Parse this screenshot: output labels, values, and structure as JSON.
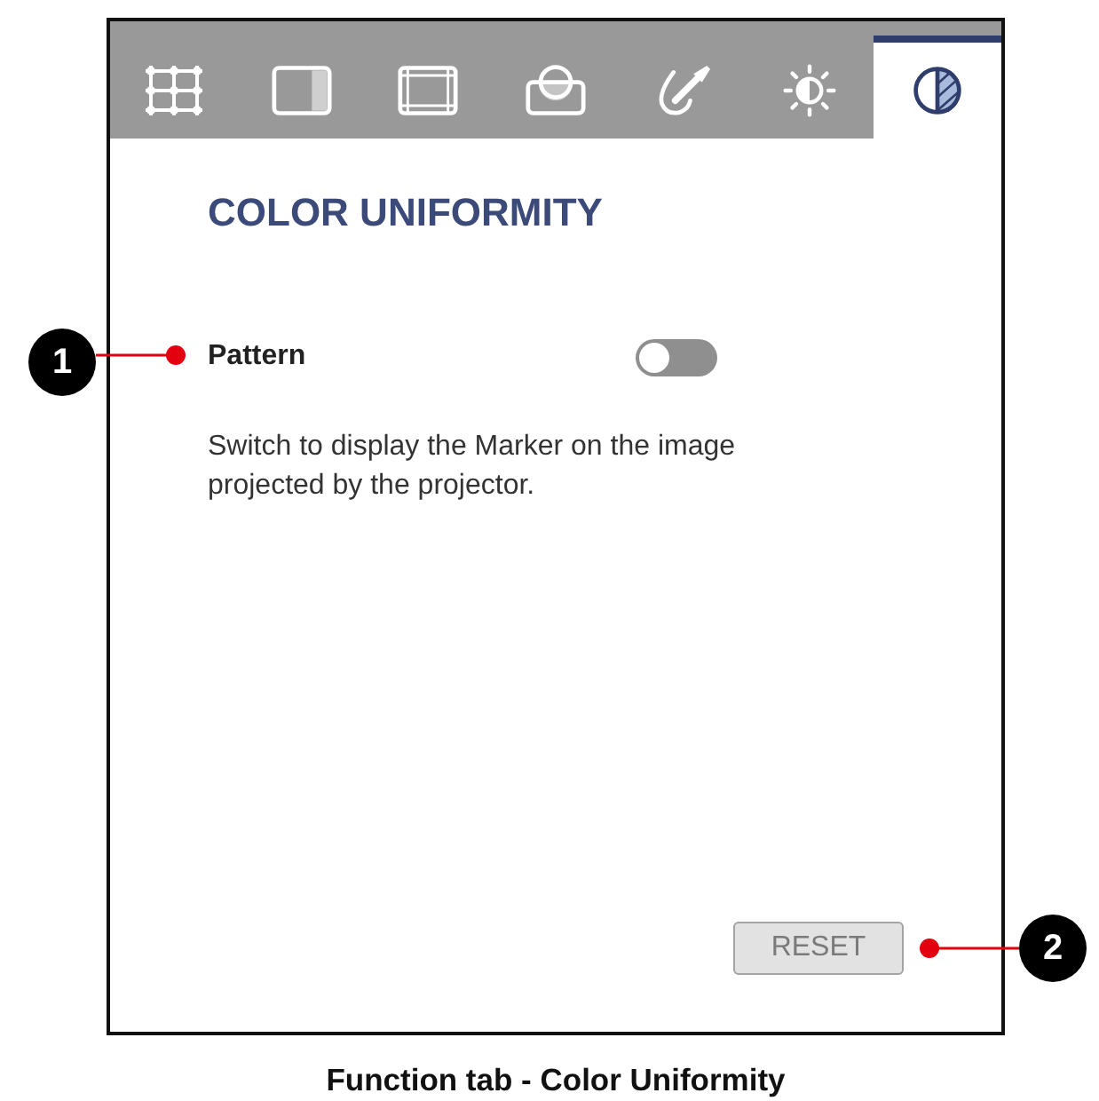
{
  "tabs": [
    {
      "selected": false
    },
    {
      "selected": false
    },
    {
      "selected": false
    },
    {
      "selected": false
    },
    {
      "selected": false
    },
    {
      "selected": false
    },
    {
      "selected": true
    }
  ],
  "panel": {
    "title": "COLOR UNIFORMITY",
    "settings": [
      {
        "label": "Pattern",
        "on": false,
        "description": "Switch to display the Marker on the image projected by the projector.",
        "callout": "1"
      }
    ],
    "reset_button": {
      "label": "RESET",
      "callout": "2"
    }
  },
  "caption": "Function tab - Color Uniformity"
}
